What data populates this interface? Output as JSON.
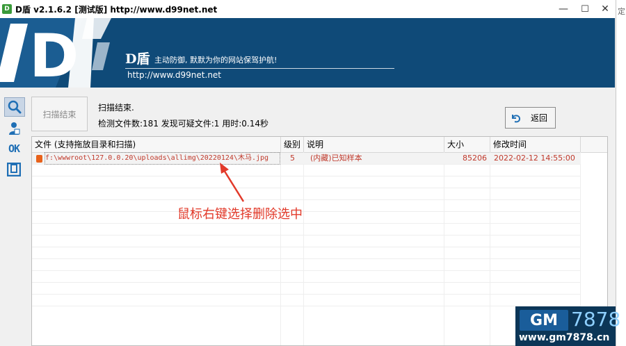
{
  "window": {
    "title": "D盾 v2.1.6.2 [测试版] http://www.d99net.net",
    "app_icon": "D",
    "minimize_symbol": "—",
    "maximize_symbol": "☐",
    "close_symbol": "✕",
    "side_glyph": "定"
  },
  "banner": {
    "logo_letter": "D",
    "brand": "D盾",
    "slogan": "主动防御, 默默为你的网站保驾护航!",
    "url": "http://www.d99net.net",
    "bg_color": "#0f4a78"
  },
  "sidebar": {
    "items": [
      {
        "name": "scan",
        "icon": "search-icon",
        "active": true
      },
      {
        "name": "user",
        "icon": "user-icon",
        "active": false
      },
      {
        "name": "ok",
        "label": "OK",
        "active": false
      },
      {
        "name": "tools",
        "icon": "box-icon",
        "active": false
      }
    ]
  },
  "toolbar": {
    "scan_button_label": "扫描结束",
    "back_button_label": "返回",
    "status_title": "扫描结束.",
    "status_detail": "检测文件数:181 发现可疑文件:1 用时:0.14秒"
  },
  "table": {
    "columns": [
      {
        "key": "file",
        "label": "文件 (支持拖放目录和扫描)"
      },
      {
        "key": "level",
        "label": "级别"
      },
      {
        "key": "desc",
        "label": "说明"
      },
      {
        "key": "size",
        "label": "大小"
      },
      {
        "key": "mtime",
        "label": "修改时间"
      }
    ],
    "rows": [
      {
        "file": "f:\\wwwroot\\127.0.0.20\\uploads\\allimg\\20220124\\木马.jpg",
        "level": "5",
        "desc": "(内藏)已知样本",
        "size": "85206",
        "mtime": "2022-02-12 14:55:00"
      }
    ],
    "alert_color": "#c0392b"
  },
  "annotation": {
    "text": "鼠标右键选择删除选中",
    "color": "#e23a2a"
  },
  "watermark": {
    "badge": "GM",
    "number": "7878",
    "url": "www.gm7878.cn"
  }
}
